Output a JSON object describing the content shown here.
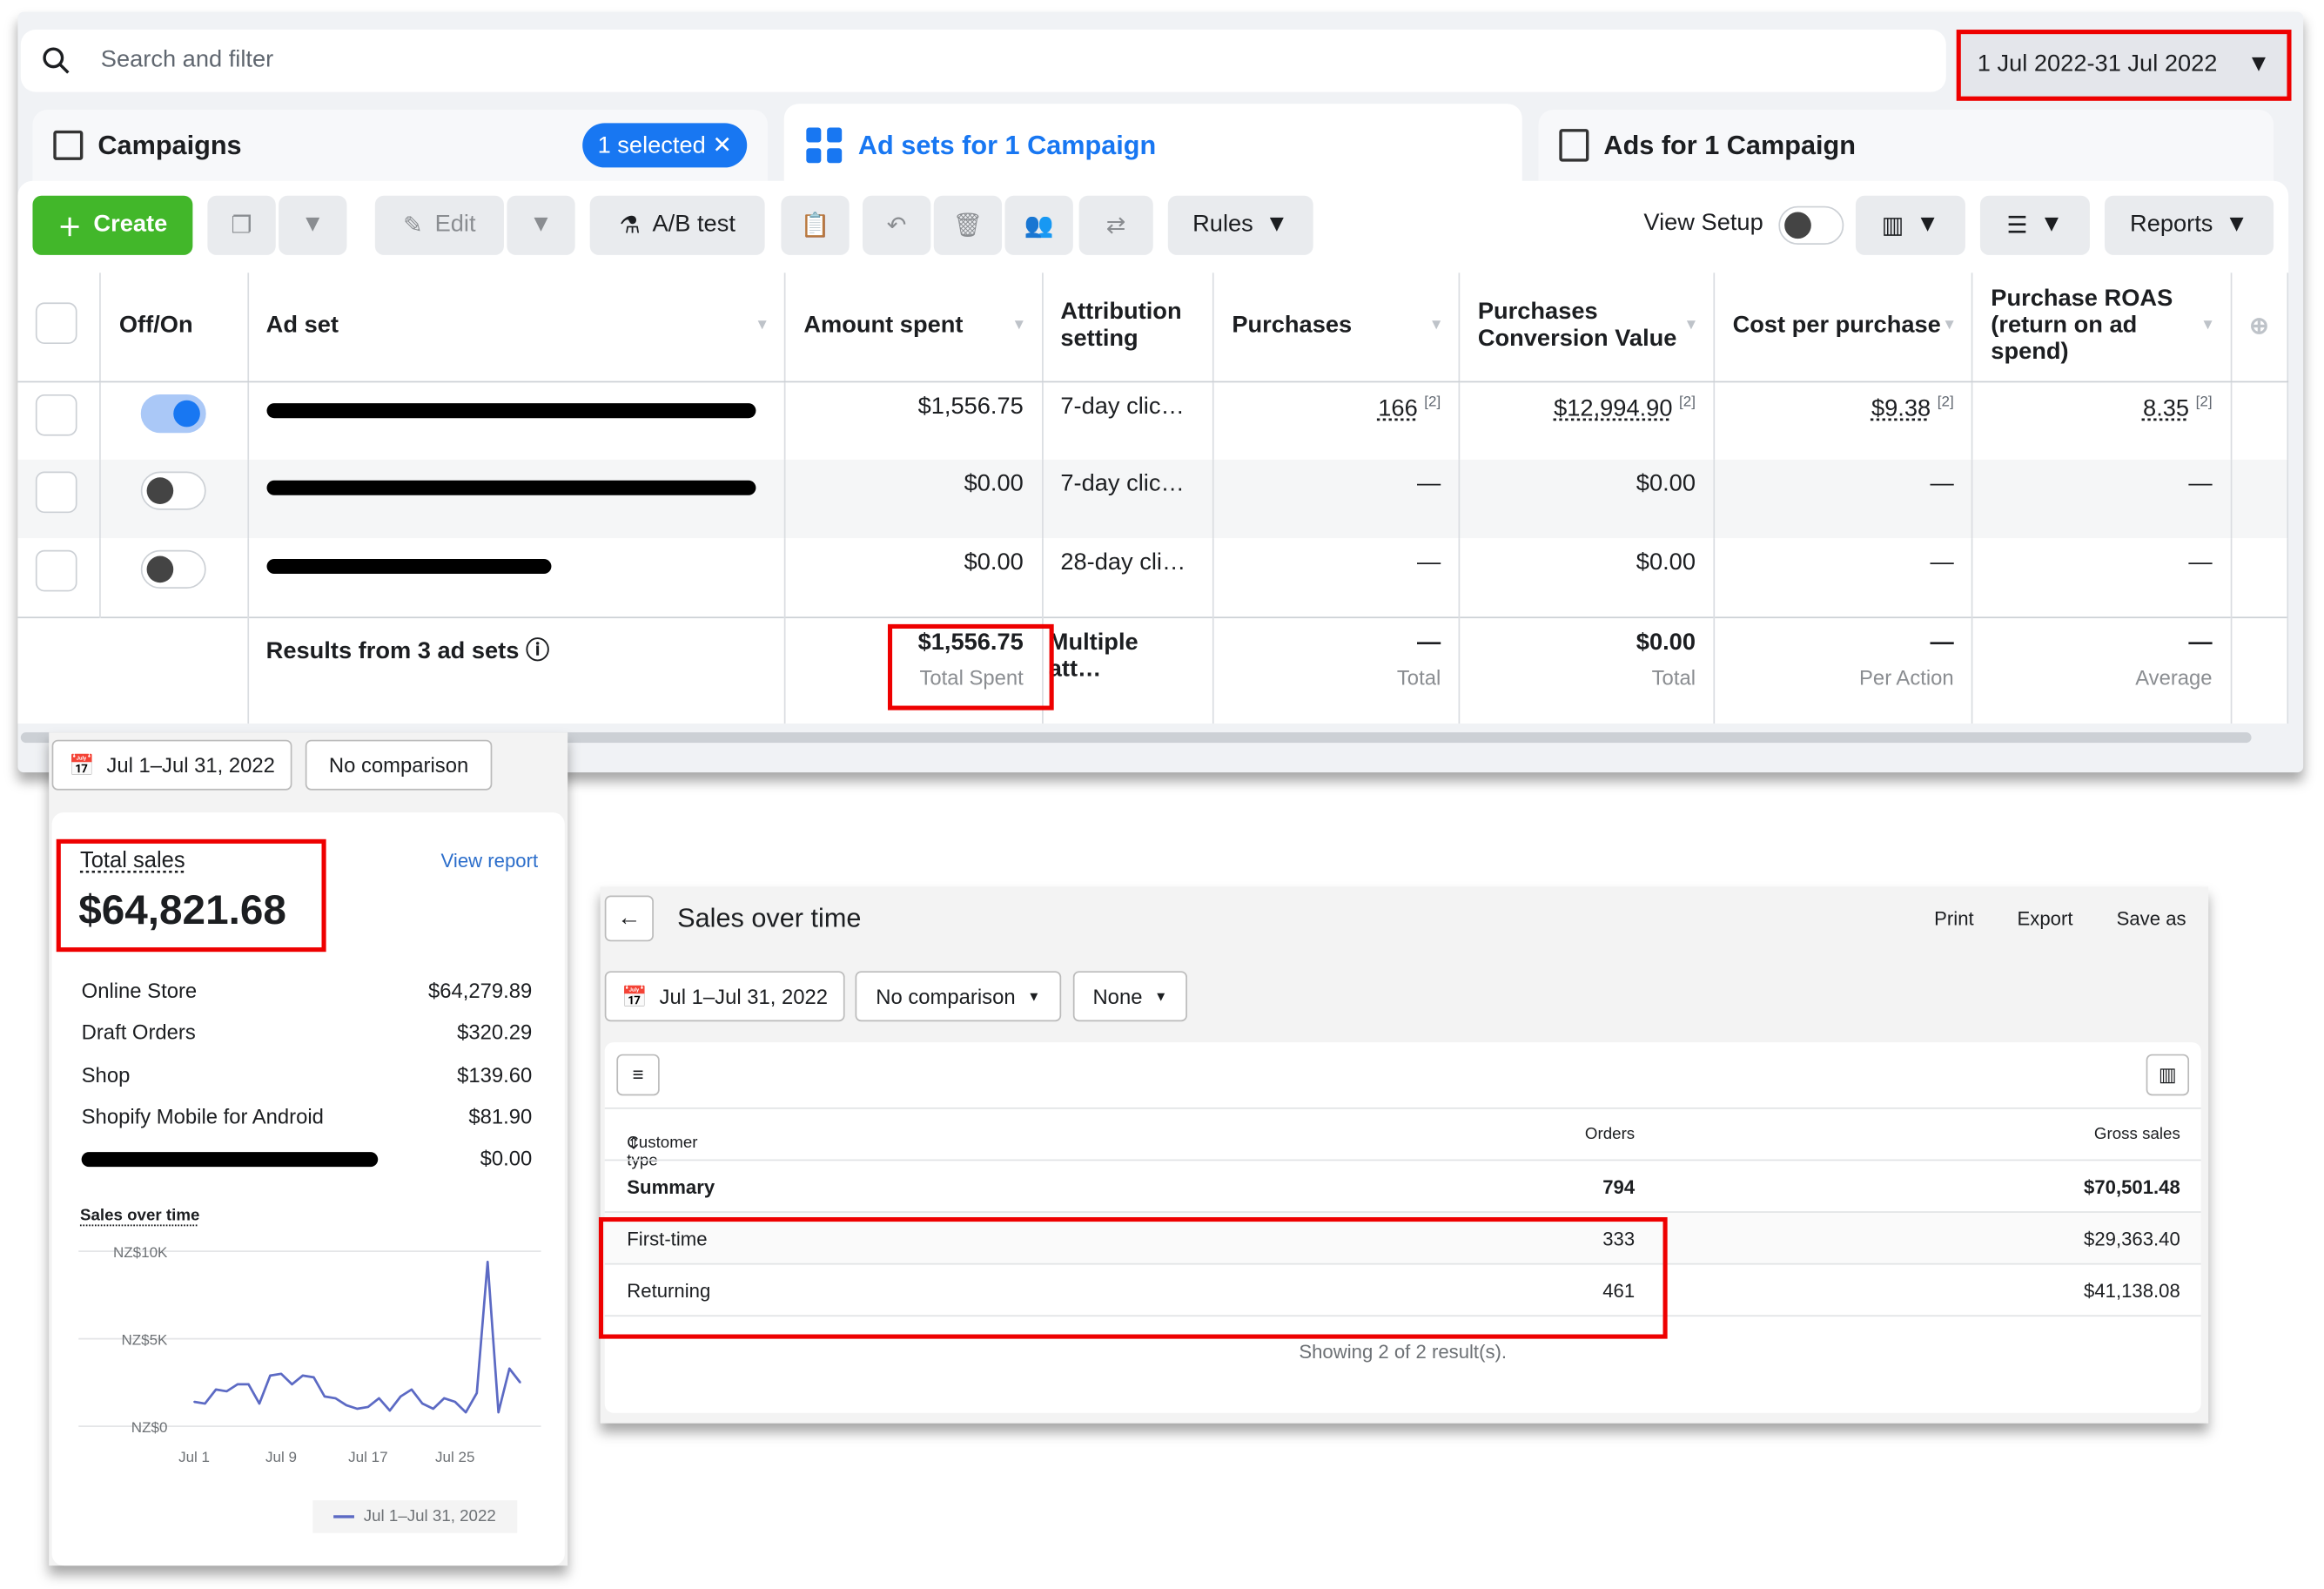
{
  "ads_manager": {
    "search_placeholder": "Search and filter",
    "date_range": "1 Jul 2022-31 Jul 2022",
    "tabs": [
      {
        "label": "Campaigns",
        "badge": "1 selected"
      },
      {
        "label": "Ad sets for 1 Campaign"
      },
      {
        "label": "Ads for 1 Campaign"
      }
    ],
    "toolbar": {
      "create": "Create",
      "edit": "Edit",
      "ab_test": "A/B test",
      "rules": "Rules",
      "view_setup": "View Setup",
      "reports": "Reports"
    },
    "columns": [
      "Off/On",
      "Ad set",
      "Amount spent",
      "Attribution setting",
      "Purchases",
      "Purchases Conversion Value",
      "Cost per purchase",
      "Purchase ROAS (return on ad spend)"
    ],
    "rows": [
      {
        "on": true,
        "amount": "$1,556.75",
        "attribution": "7-day clic…",
        "purchases": "166",
        "purchases_note": "[2]",
        "conv_value": "$12,994.90",
        "conv_note": "[2]",
        "cpp": "$9.38",
        "cpp_note": "[2]",
        "roas": "8.35",
        "roas_note": "[2]"
      },
      {
        "on": false,
        "amount": "$0.00",
        "attribution": "7-day clic…",
        "purchases": "—",
        "conv_value": "$0.00",
        "cpp": "—",
        "roas": "—"
      },
      {
        "on": false,
        "amount": "$0.00",
        "attribution": "28-day cli…",
        "purchases": "—",
        "conv_value": "$0.00",
        "cpp": "—",
        "roas": "—"
      }
    ],
    "totals": {
      "label": "Results from 3 ad sets",
      "amount": "$1,556.75",
      "amount_sub": "Total Spent",
      "attribution": "Multiple att…",
      "purchases": "—",
      "purchases_sub": "Total",
      "conv_value": "$0.00",
      "conv_sub": "Total",
      "cpp": "—",
      "cpp_sub": "Per Action",
      "roas": "—",
      "roas_sub": "Average"
    }
  },
  "shopify_overview": {
    "date": "Jul 1–Jul 31, 2022",
    "comparison": "No comparison",
    "total_label": "Total sales",
    "total": "$64,821.68",
    "view_report": "View report",
    "channels": [
      {
        "name": "Online Store",
        "value": "$64,279.89"
      },
      {
        "name": "Draft Orders",
        "value": "$320.29"
      },
      {
        "name": "Shop",
        "value": "$139.60"
      },
      {
        "name": "Shopify Mobile for Android",
        "value": "$81.90"
      },
      {
        "name": "",
        "value": "$0.00"
      }
    ],
    "chart_title": "Sales over time"
  },
  "chart_data": {
    "type": "line",
    "title": "Sales over time",
    "y_ticks": [
      "NZ$0",
      "NZ$5K",
      "NZ$10K"
    ],
    "ylim": [
      0,
      10000
    ],
    "x_ticks": [
      "Jul 1",
      "Jul 9",
      "Jul 17",
      "Jul 25"
    ],
    "legend": "Jul 1–Jul 31, 2022",
    "color": "#5c6ac4",
    "series": [
      {
        "name": "Jul 1–Jul 31, 2022",
        "values": [
          1400,
          1300,
          2100,
          2000,
          2400,
          2400,
          1300,
          2900,
          3000,
          2400,
          2900,
          2800,
          1700,
          1600,
          1200,
          1000,
          1100,
          1600,
          900,
          1700,
          2100,
          1300,
          1000,
          1600,
          1400,
          800,
          1900,
          9400,
          800,
          3300,
          2500
        ]
      }
    ]
  },
  "sales_report": {
    "title": "Sales over time",
    "print": "Print",
    "export": "Export",
    "save_as": "Save as",
    "date": "Jul 1–Jul 31, 2022",
    "comparison": "No comparison",
    "group": "None",
    "headers": [
      "Customer type",
      "Orders",
      "Gross sales"
    ],
    "summary": {
      "label": "Summary",
      "orders": "794",
      "gross": "$70,501.48"
    },
    "rows": [
      {
        "type": "First-time",
        "orders": "333",
        "gross": "$29,363.40"
      },
      {
        "type": "Returning",
        "orders": "461",
        "gross": "$41,138.08"
      }
    ],
    "footer": "Showing 2 of 2 result(s)."
  }
}
